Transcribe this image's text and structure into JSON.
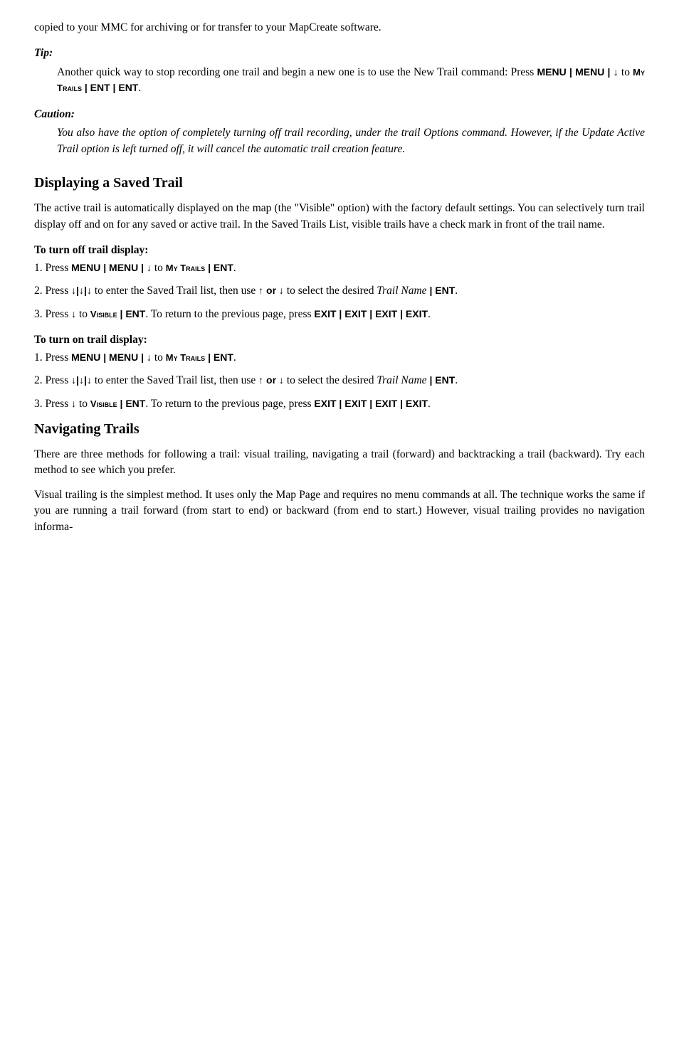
{
  "page": {
    "intro": "copied to your MMC for archiving or for transfer to your MapCreate software.",
    "tip": {
      "label": "Tip:",
      "text": "Another quick way to stop recording one trail and begin a new one is to use the New Trail command: Press "
    },
    "tip_command": "MENU | MENU | ↓ to My Trails | ENT | ENT.",
    "caution": {
      "label": "Caution:",
      "text": "You also have the option of completely turning off trail recording, under the trail Options command. However, if the Update Active Trail option is left turned off, it will cancel the automatic trail creation feature."
    },
    "section1": {
      "heading": "Displaying a Saved Trail",
      "para1": "The active trail is automatically displayed on the map (the \"Visible\" option) with the factory default settings. You can selectively turn trail display off and on for any saved or active trail. In the Saved Trails List, visible trails have a check mark in front of the trail name.",
      "turnoff": {
        "heading": "To turn off trail display:",
        "step1_pre": "1. Press ",
        "step1_cmd": "MENU | MENU | ↓ to My Trails | ENT",
        "step1_end": ".",
        "step2_pre": "2. Press ",
        "step2_arrows": "↓|↓|↓",
        "step2_mid": " to enter the Saved Trail list, then use ",
        "step2_arrows2": "↑ or ↓",
        "step2_end": " to select the desired ",
        "step2_italic": "Trail Name",
        "step2_ent": "| ENT",
        "step2_period": ".",
        "step3_pre": "3. Press ",
        "step3_arrow": "↓",
        "step3_mid": " to ",
        "step3_cmd": "Visible | ENT",
        "step3_end": ". To return to the previous page, press ",
        "step3_cmd2": "EXIT | EXIT | EXIT | EXIT",
        "step3_period": "."
      },
      "turnon": {
        "heading": "To turn on trail display:",
        "step1_pre": "1. Press ",
        "step1_cmd": "MENU | MENU | ↓ to My Trails | ENT",
        "step1_end": ".",
        "step2_pre": "2. Press ",
        "step2_arrows": "↓|↓|↓",
        "step2_mid": " to enter the Saved Trail list, then use ",
        "step2_arrows2": "↑ or ↓",
        "step2_end": " to select the desired ",
        "step2_italic": "Trail Name",
        "step2_ent": "| ENT",
        "step2_period": ".",
        "step3_pre": "3. Press ",
        "step3_arrow": "↓",
        "step3_mid": " to ",
        "step3_cmd": "Visible | ENT",
        "step3_end": ". To return to the previous page, press ",
        "step3_cmd2": "EXIT | EXIT | EXIT | EXIT",
        "step3_period": "."
      }
    },
    "section2": {
      "heading": "Navigating Trails",
      "para1": "There are three methods for following a trail: visual trailing, navigating a trail (forward) and backtracking a trail (backward). Try each method to see which you prefer.",
      "para2": "Visual trailing is the simplest method. It uses only the Map Page and requires no menu commands at all. The technique works the same if you are running a trail forward (from start to end) or backward (from end to start.) However, visual trailing provides no navigation informa-"
    }
  }
}
